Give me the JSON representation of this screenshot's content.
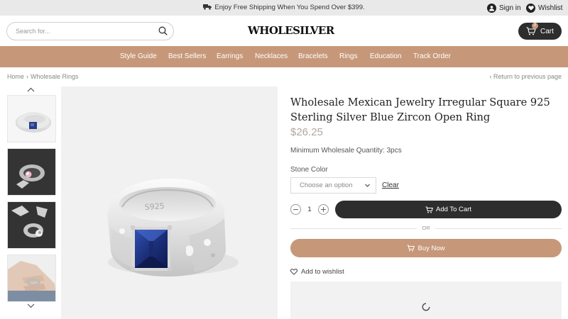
{
  "topbar": {
    "promo_text": "Enjoy Free Shipping When You Spend Over $399.",
    "signin_label": "Sign in",
    "wishlist_label": "Wishlist"
  },
  "header": {
    "search_placeholder": "Search for...",
    "logo_text": "WHOLESILVER",
    "cart_label": "Cart",
    "cart_count": "0"
  },
  "nav": {
    "items": [
      "Style Guide",
      "Best Sellers",
      "Earrings",
      "Necklaces",
      "Bracelets",
      "Rings",
      "Education",
      "Track Order"
    ]
  },
  "breadcrumb": {
    "home": "Home",
    "separator": "›",
    "current": "Wholesale Rings",
    "return_link": "‹ Return to previous page"
  },
  "gallery": {
    "thumbnails": [
      "ring-on-white",
      "ring-pink-stone-dark",
      "ring-clear-stone-dark",
      "ring-on-hand"
    ],
    "main_image": "blue-zircon-ring",
    "ring_engraving": "S925"
  },
  "product": {
    "title": "Wholesale Mexican Jewelry Irregular Square 925 Sterling Silver Blue Zircon Open Ring",
    "price": "$26.25",
    "min_qty": "Minimum Wholesale Quantity: 3pcs",
    "stone_color_label": "Stone Color",
    "stone_color_placeholder": "Choose an option",
    "clear_label": "Clear",
    "quantity": "1",
    "add_to_cart_label": "Add To Cart",
    "or_label": "OR",
    "buy_now_label": "Buy Now",
    "wishlist_label": "Add to wishlist"
  },
  "colors": {
    "accent": "#c69879",
    "dark": "#2d2d2d",
    "topbar_bg": "#e9e9e9",
    "price": "#b3a69e",
    "stone_blue": "#1f3f8c"
  }
}
